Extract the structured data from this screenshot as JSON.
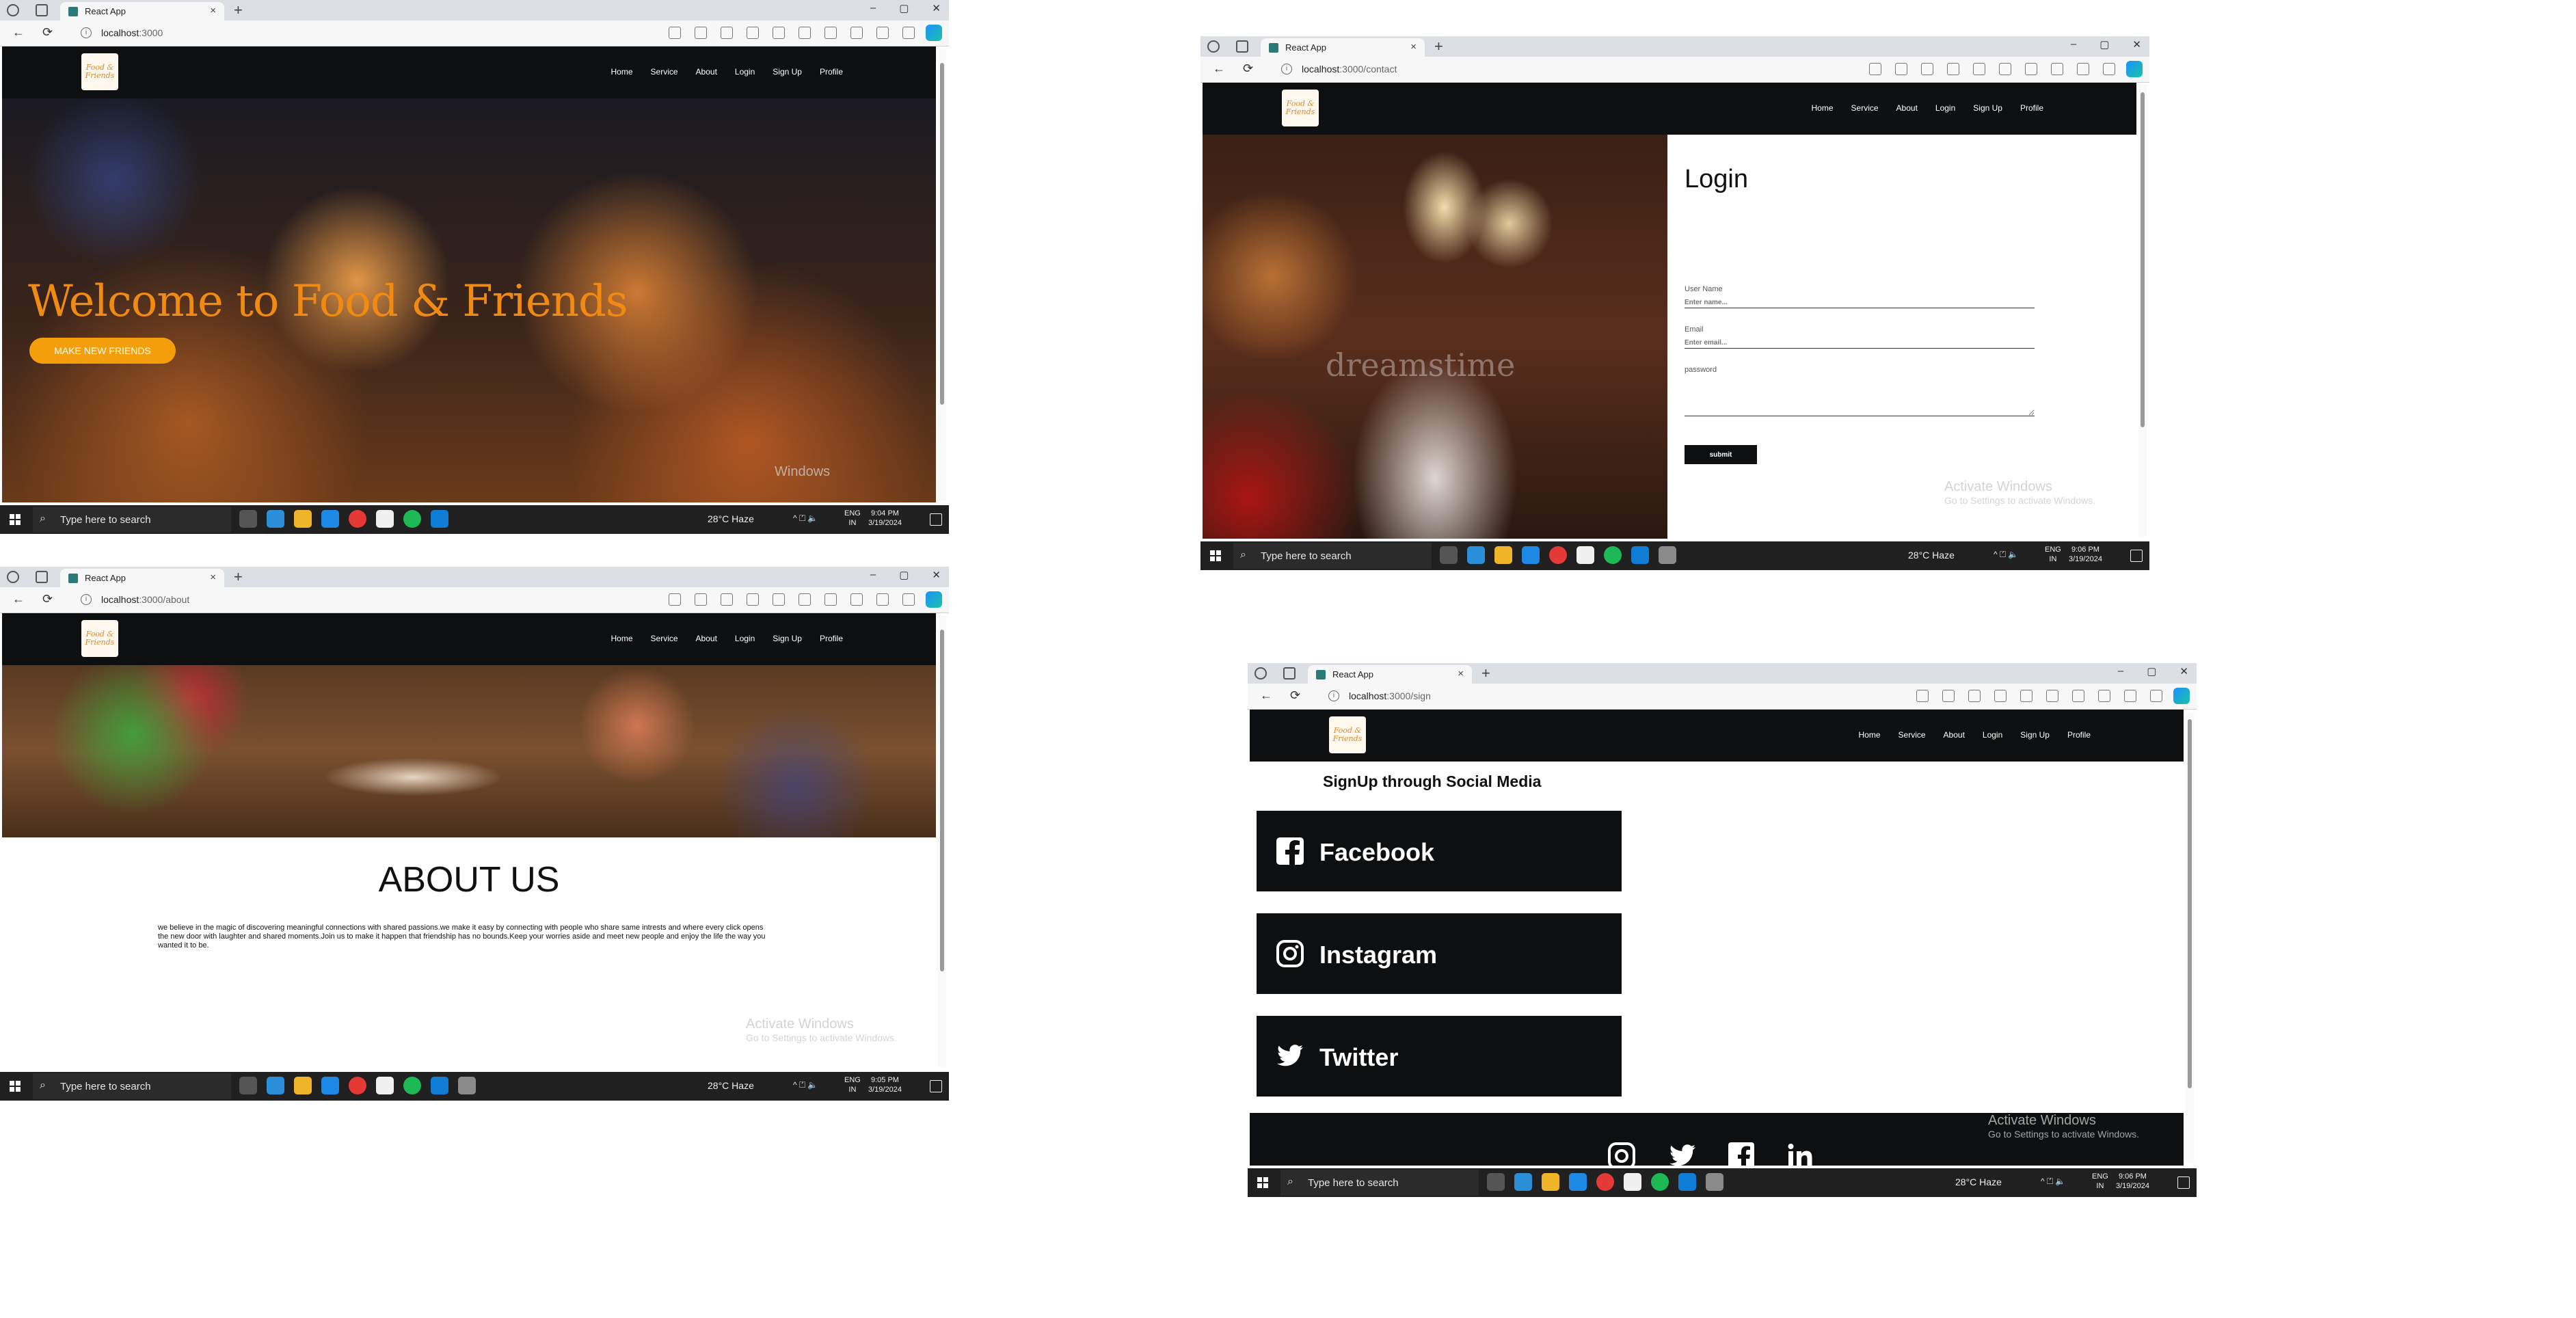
{
  "browser": {
    "tab_title": "React App",
    "tab_close": "×",
    "new_tab": "+",
    "window_controls": [
      "–",
      "▢",
      "✕"
    ],
    "nav_icons": [
      "←",
      "⟳"
    ]
  },
  "site": {
    "logo_text": "Food & Friends",
    "nav": [
      "Home",
      "Service",
      "About",
      "Login",
      "Sign Up",
      "Profile"
    ]
  },
  "home": {
    "url_host": "localhost",
    "url_path": ":3000",
    "hero_title": "Welcome to Food & Friends",
    "hero_button": "MAKE NEW FRIENDS",
    "watermark": "Windows"
  },
  "contact": {
    "url_host": "localhost",
    "url_path": ":3000/contact",
    "image_watermark": "dreamstime",
    "login_title": "Login",
    "username_label": "User Name",
    "username_placeholder": "Enter name...",
    "email_label": "Email",
    "email_placeholder": "Enter email...",
    "password_label": "password",
    "submit_label": "submit",
    "clock_time": "9:06 PM",
    "clock_date": "3/19/2024"
  },
  "about": {
    "url_host": "localhost",
    "url_path": ":3000/about",
    "title": "ABOUT US",
    "body": "we believe in the magic of discovering meaningful connections with shared passions.we make it easy by connecting with people who share same intrests and where every click opens the new door with laughter and shared moments.Join us to make it happen that friendship has no bounds.Keep your worries aside and meet new people and enjoy the life the way you wanted it to be.",
    "clock_time": "9:05 PM",
    "clock_date": "3/19/2024"
  },
  "signup": {
    "url_host": "localhost",
    "url_path": ":3000/sign",
    "title": "SignUp through Social Media",
    "buttons": [
      "Facebook",
      "Instagram",
      "Twitter"
    ],
    "clock_time": "9:06 PM",
    "clock_date": "3/19/2024"
  },
  "activate_windows": {
    "title": "Activate Windows",
    "subtitle": "Go to Settings to activate Windows."
  },
  "taskbar": {
    "search_placeholder": "Type here to search",
    "weather": "28°C  Haze",
    "tray": "^  ⏍  🔈",
    "lang_1": "ENG",
    "lang_2": "IN",
    "home_time": "9:04 PM",
    "home_date": "3/19/2024",
    "app_colors": [
      "#3a6fd8",
      "#f0b429",
      "#1e88e5",
      "#e53935",
      "#43a047",
      "#1db954",
      "#0f7dd6",
      "#8a8a8a"
    ]
  },
  "colors": {
    "nav_bg": "#0d0f10",
    "accent_orange": "#f08a12",
    "button_orange": "#f59e0b"
  }
}
